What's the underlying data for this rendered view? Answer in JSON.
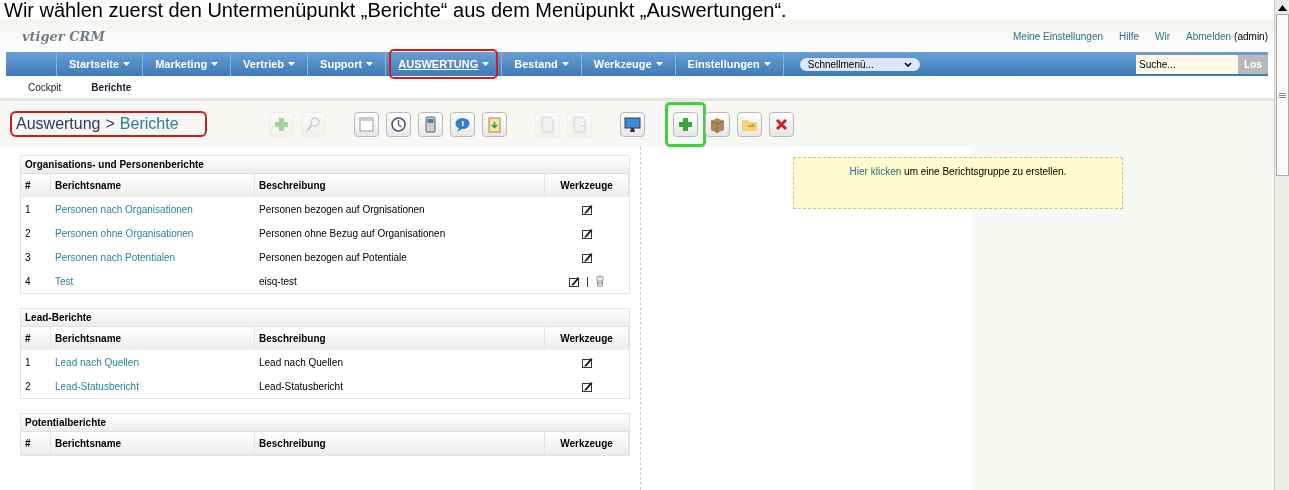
{
  "caption": "Wir wählen zuerst den Untermenüpunkt „Berichte“ aus dem Menüpunkt „Auswertungen“.",
  "logo": "vtiger CRM",
  "top_links": [
    {
      "label": "Meine Einstellungen",
      "kind": "link"
    },
    {
      "label": "Hilfe",
      "kind": "link"
    },
    {
      "label": "Wir",
      "kind": "link"
    },
    {
      "label": "Abmelden",
      "kind": "link"
    },
    {
      "label": "(admin)",
      "kind": "text"
    }
  ],
  "nav": [
    {
      "label": "Startseite",
      "selected": false,
      "annotated": false
    },
    {
      "label": "Marketing",
      "selected": false,
      "annotated": false
    },
    {
      "label": "Vertrieb",
      "selected": false,
      "annotated": false
    },
    {
      "label": "Support",
      "selected": false,
      "annotated": false
    },
    {
      "label": "AUSWERTUNG",
      "selected": true,
      "annotated": true
    },
    {
      "label": "Bestand",
      "selected": false,
      "annotated": false
    },
    {
      "label": "Werkzeuge",
      "selected": false,
      "annotated": false
    },
    {
      "label": "Einstellungen",
      "selected": false,
      "annotated": false
    }
  ],
  "quick_menu": {
    "value": "Schnellmenü..."
  },
  "search": {
    "placeholder": "Suche...",
    "button": "Los"
  },
  "subnav": [
    {
      "label": "Cockpit",
      "selected": false
    },
    {
      "label": "Berichte",
      "selected": true
    }
  ],
  "breadcrumb": {
    "parent": "Auswertung",
    "separator": ">",
    "current": "Berichte",
    "annotated": true
  },
  "toolbar": [
    [
      {
        "kind": "add",
        "disabled": true,
        "annotated": false
      },
      {
        "kind": "search",
        "disabled": true,
        "annotated": false
      }
    ],
    [
      {
        "kind": "calendar",
        "disabled": false,
        "annotated": false
      },
      {
        "kind": "clock",
        "disabled": false,
        "annotated": false
      },
      {
        "kind": "calculator",
        "disabled": false,
        "annotated": false
      },
      {
        "kind": "chat",
        "disabled": false,
        "annotated": false
      },
      {
        "kind": "clipboard",
        "disabled": false,
        "annotated": false
      }
    ],
    [
      {
        "kind": "import",
        "disabled": true,
        "annotated": false
      },
      {
        "kind": "export",
        "disabled": true,
        "annotated": false
      }
    ],
    [
      {
        "kind": "monitor",
        "disabled": false,
        "annotated": false
      }
    ],
    [
      {
        "kind": "add",
        "disabled": false,
        "annotated": true
      },
      {
        "kind": "box",
        "disabled": false,
        "annotated": false
      },
      {
        "kind": "folder",
        "disabled": false,
        "annotated": false
      },
      {
        "kind": "delete",
        "disabled": false,
        "annotated": false
      }
    ]
  ],
  "report_groups": [
    {
      "title": "Organisations- und Personenberichte",
      "columns": [
        "#",
        "Berichtsname",
        "Beschreibung",
        "Werkzeuge"
      ],
      "rows": [
        {
          "no": "1",
          "name": "Personen nach Organisationen",
          "description": "Personen bezogen auf Orgnisationen",
          "deletable": false
        },
        {
          "no": "2",
          "name": "Personen ohne Organisationen",
          "description": "Personen ohne Bezug auf Organisationen",
          "deletable": false
        },
        {
          "no": "3",
          "name": "Personen nach Potentialen",
          "description": "Personen bezogen auf Potentiale",
          "deletable": false
        },
        {
          "no": "4",
          "name": "Test",
          "description": "eisq-test",
          "deletable": true,
          "separator": "|"
        }
      ]
    },
    {
      "title": "Lead-Berichte",
      "columns": [
        "#",
        "Berichtsname",
        "Beschreibung",
        "Werkzeuge"
      ],
      "rows": [
        {
          "no": "1",
          "name": "Lead nach Quellen",
          "description": "Lead nach Quellen",
          "deletable": false
        },
        {
          "no": "2",
          "name": "Lead-Statusbericht",
          "description": "Lead-Statusbericht",
          "deletable": false
        }
      ]
    },
    {
      "title": "Potentialberichte",
      "columns": [
        "#",
        "Berichtsname",
        "Beschreibung",
        "Werkzeuge"
      ]
    }
  ],
  "create_group_hint": {
    "link": "Hier klicken",
    "text": "um eine Berichtsgruppe zu erstellen."
  }
}
